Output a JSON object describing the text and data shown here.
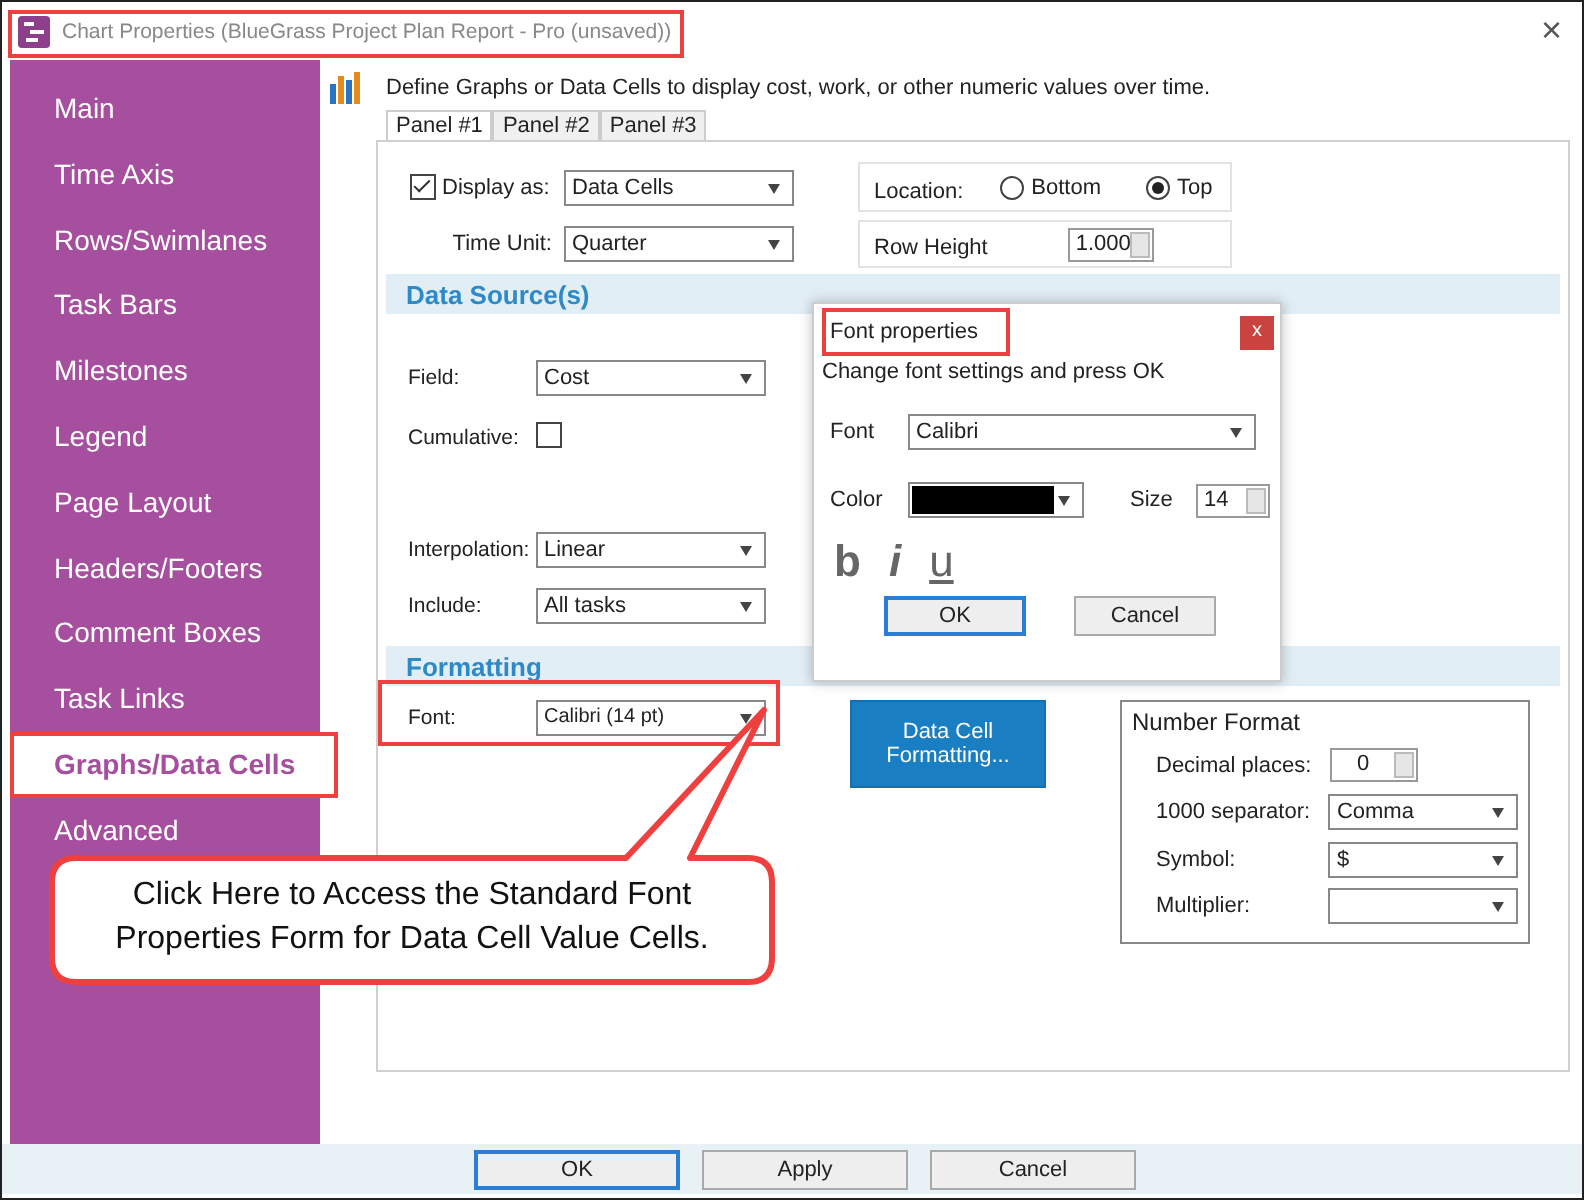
{
  "window": {
    "title": "Chart Properties (BlueGrass Project Plan Report - Pro (unsaved))",
    "close": "×"
  },
  "sidebar": {
    "items": [
      {
        "label": "Main",
        "selected": false
      },
      {
        "label": "Time Axis",
        "selected": false
      },
      {
        "label": "Rows/Swimlanes",
        "selected": false
      },
      {
        "label": "Task Bars",
        "selected": false
      },
      {
        "label": "Milestones",
        "selected": false
      },
      {
        "label": "Legend",
        "selected": false
      },
      {
        "label": "Page Layout",
        "selected": false
      },
      {
        "label": "Headers/Footers",
        "selected": false
      },
      {
        "label": "Comment Boxes",
        "selected": false
      },
      {
        "label": "Task Links",
        "selected": false
      },
      {
        "label": "Graphs/Data Cells",
        "selected": true
      },
      {
        "label": "Advanced",
        "selected": false
      }
    ]
  },
  "description": "Define Graphs or Data Cells to display cost, work, or other numeric values over time.",
  "tabs": [
    {
      "label": "Panel #1",
      "selected": true
    },
    {
      "label": "Panel #2",
      "selected": false
    },
    {
      "label": "Panel #3",
      "selected": false
    }
  ],
  "display": {
    "label": "Display as:",
    "checked": true,
    "value": "Data Cells"
  },
  "location": {
    "label": "Location:",
    "options": [
      {
        "label": "Bottom",
        "selected": false
      },
      {
        "label": "Top",
        "selected": true
      }
    ]
  },
  "time_unit": {
    "label": "Time Unit:",
    "value": "Quarter"
  },
  "row_height": {
    "label": "Row Height",
    "value": "1.000"
  },
  "data_source": {
    "heading": "Data Source(s)",
    "field": {
      "label": "Field:",
      "value": "Cost"
    },
    "cumulative": {
      "label": "Cumulative:",
      "checked": false
    },
    "interpolation": {
      "label": "Interpolation:",
      "value": "Linear"
    },
    "include": {
      "label": "Include:",
      "value": "All tasks"
    }
  },
  "formatting": {
    "heading": "Formatting",
    "font": {
      "label": "Font:",
      "value": "Calibri (14 pt)"
    },
    "data_cell_button": {
      "lines": [
        "Data Cell",
        "Formatting..."
      ]
    },
    "number_format": {
      "title": "Number Format",
      "decimal_places": {
        "label": "Decimal places:",
        "value": "0"
      },
      "separator": {
        "label": "1000 separator:",
        "value": "Comma"
      },
      "symbol": {
        "label": "Symbol:",
        "value": "$"
      },
      "multiplier": {
        "label": "Multiplier:"
      }
    }
  },
  "font_dialog": {
    "title": "Font properties",
    "close": "x",
    "instruction": "Change font settings and press OK",
    "font": {
      "label": "Font",
      "value": "Calibri"
    },
    "color": {
      "label": "Color",
      "color": "#000000"
    },
    "size": {
      "label": "Size",
      "value": "14"
    },
    "styles": [
      {
        "label": "b",
        "kind": "bold"
      },
      {
        "label": "i",
        "kind": "italic"
      },
      {
        "label": "u",
        "kind": "underline"
      }
    ],
    "buttons": [
      {
        "label": "OK",
        "focused": true
      },
      {
        "label": "Cancel",
        "focused": false
      }
    ]
  },
  "callout": {
    "text": "Click Here to Access the Standard Font Properties Form for Data Cell Value Cells."
  },
  "buttons": [
    {
      "label": "OK",
      "focused": true
    },
    {
      "label": "Apply",
      "focused": false
    },
    {
      "label": "Cancel",
      "focused": false
    }
  ]
}
